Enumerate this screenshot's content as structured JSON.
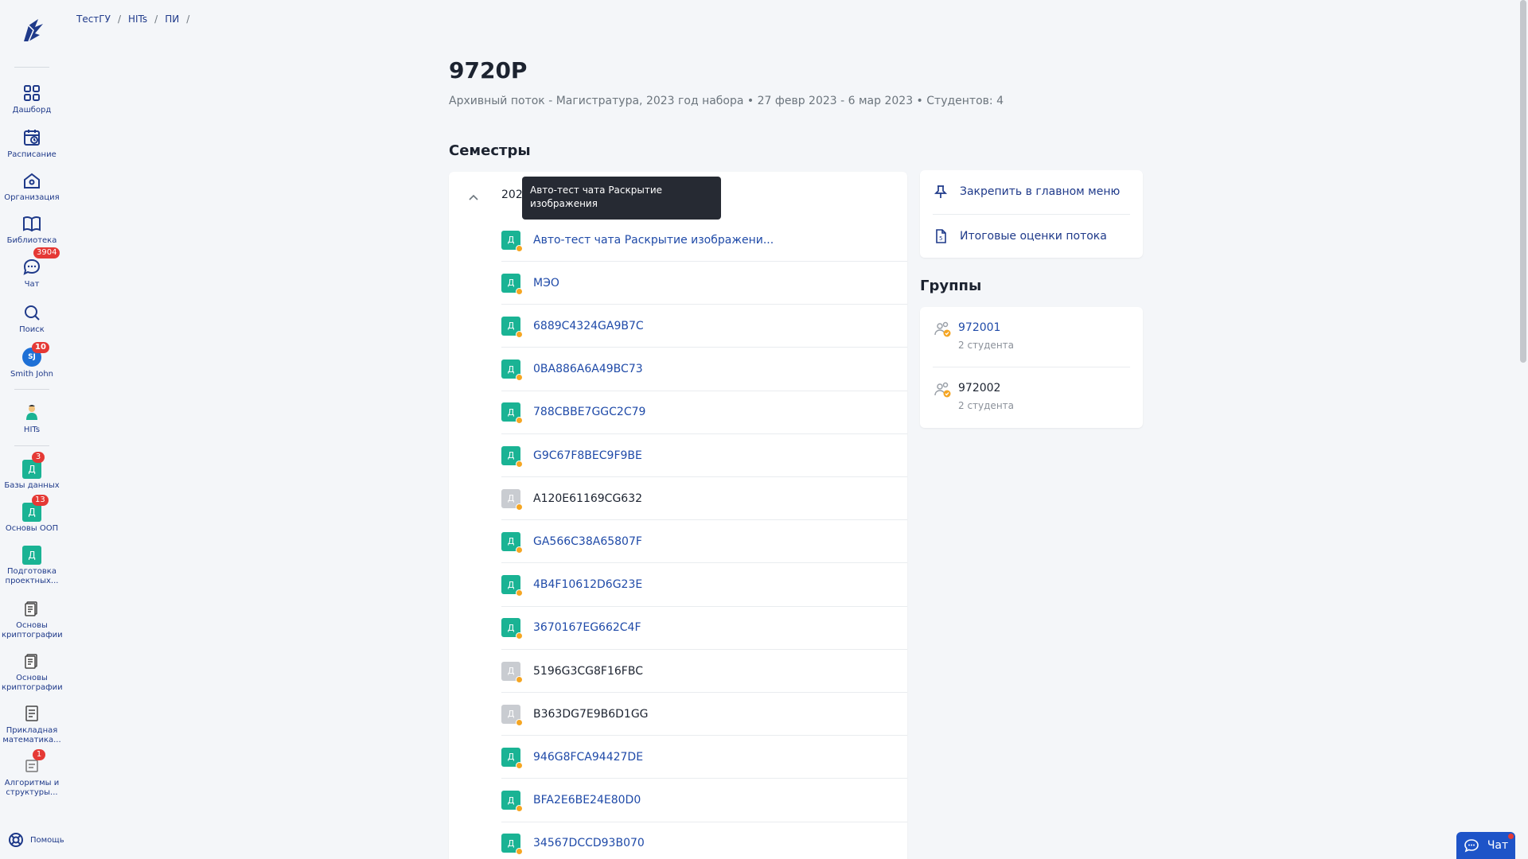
{
  "breadcrumb": [
    "ТестГУ",
    "HITs",
    "ПИ"
  ],
  "page": {
    "title": "9720Р",
    "subtitle": "Архивный поток - Магистратура, 2023 год набора • 27 февр 2023 - 6 мар 2023 • Студентов: 4"
  },
  "sidebar": {
    "nav": [
      {
        "label": "Дашборд",
        "icon": "grid-icon"
      },
      {
        "label": "Расписание",
        "icon": "calendar-icon"
      },
      {
        "label": "Организация",
        "icon": "home-icon"
      },
      {
        "label": "Библиотека",
        "icon": "book-icon"
      },
      {
        "label": "Чат",
        "icon": "chat-icon",
        "badge": "3904"
      },
      {
        "label": "Поиск",
        "icon": "search-icon"
      }
    ],
    "user": {
      "label": "Smith John",
      "initials": "SJ",
      "badge": "10"
    },
    "org": {
      "label": "HITs"
    },
    "courses": [
      {
        "label": "Базы данных",
        "letter": "Д",
        "badge": "3"
      },
      {
        "label": "Основы ООП",
        "letter": "Д",
        "badge": "13"
      },
      {
        "label": "Подготовка проектных...",
        "letter": "Д"
      },
      {
        "label": "Основы криптографии"
      },
      {
        "label": "Основы криптографии"
      },
      {
        "label": "Прикладная математика..."
      },
      {
        "label": "Алгоритмы и структуры...",
        "badge": "1"
      }
    ],
    "help": "Помощь"
  },
  "semesters": {
    "title": "Семестры",
    "year": "202",
    "tooltip": "Авто-тест чата Раскрытие изображения",
    "courses": [
      {
        "name": "Авто-тест чата Раскрытие изображени...",
        "letter": "Д",
        "active": true
      },
      {
        "name": "МЭО",
        "letter": "Д",
        "active": true
      },
      {
        "name": "6889C4324GA9B7C",
        "letter": "Д",
        "active": true
      },
      {
        "name": "0BA886A6A49BC73",
        "letter": "Д",
        "active": true
      },
      {
        "name": "788CBBE7GGC2C79",
        "letter": "Д",
        "active": true
      },
      {
        "name": "G9C67F8BEC9F9BE",
        "letter": "Д",
        "active": true
      },
      {
        "name": "A120E61169CG632",
        "letter": "Д",
        "active": false
      },
      {
        "name": "GA566C38A65807F",
        "letter": "Д",
        "active": true
      },
      {
        "name": "4B4F10612D6G23E",
        "letter": "Д",
        "active": true
      },
      {
        "name": "3670167EG662C4F",
        "letter": "Д",
        "active": true
      },
      {
        "name": "5196G3CG8F16FBC",
        "letter": "Д",
        "active": false
      },
      {
        "name": "B363DG7E9B6D1GG",
        "letter": "Д",
        "active": false
      },
      {
        "name": "946G8FCA94427DE",
        "letter": "Д",
        "active": true
      },
      {
        "name": "BFA2E6BE24E80D0",
        "letter": "Д",
        "active": true
      },
      {
        "name": "34567DCCD93B070",
        "letter": "Д",
        "active": true
      }
    ]
  },
  "actions": {
    "pin": "Закрепить в главном меню",
    "grades": "Итоговые оценки потока"
  },
  "groups": {
    "title": "Группы",
    "items": [
      {
        "name": "972001",
        "count": "2 студента"
      },
      {
        "name": "972002",
        "count": "2 студента"
      }
    ]
  },
  "chat_button": "Чат",
  "colors": {
    "accent": "#1f3a8a",
    "course": "#1ab394",
    "badge": "#e53935",
    "chat": "#1e54c8"
  }
}
